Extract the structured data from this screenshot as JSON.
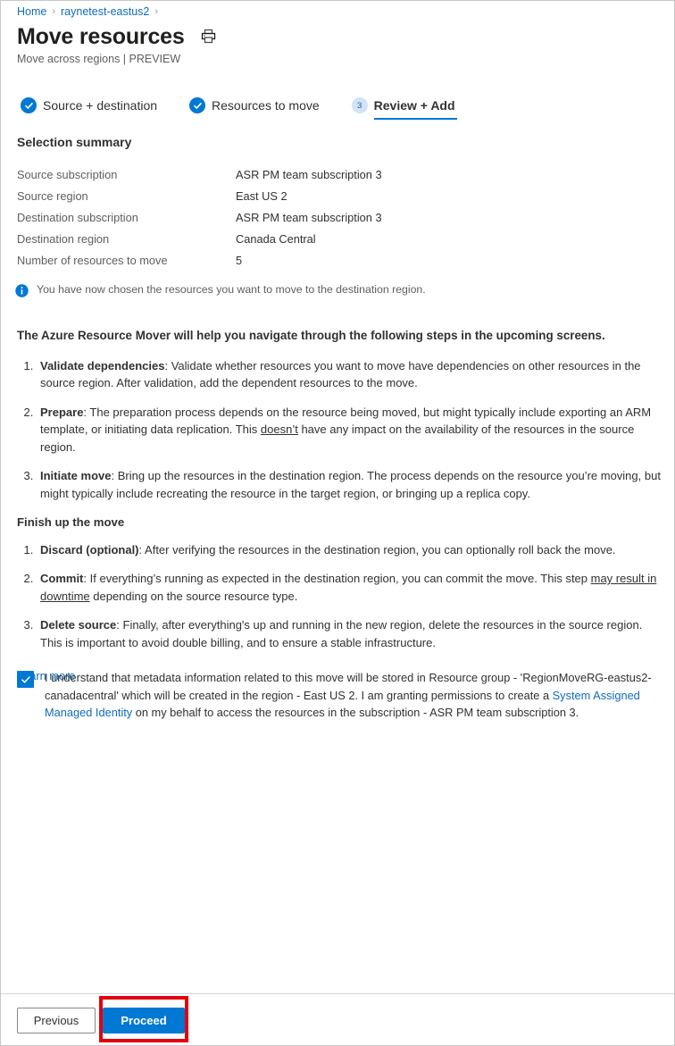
{
  "breadcrumb": {
    "items": [
      {
        "label": "Home"
      },
      {
        "label": "raynetest-eastus2"
      }
    ],
    "separator": "›"
  },
  "header": {
    "title": "Move resources",
    "subtitle": "Move across regions | PREVIEW",
    "print_icon": "print-icon"
  },
  "steps": [
    {
      "label": "Source + destination",
      "state": "done",
      "badge": "✓"
    },
    {
      "label": "Resources to move",
      "state": "done",
      "badge": "✓"
    },
    {
      "label": "Review + Add",
      "state": "active",
      "badge": "3"
    }
  ],
  "selection_summary": {
    "title": "Selection summary",
    "rows": [
      {
        "label": "Source subscription",
        "value": "ASR PM team subscription 3"
      },
      {
        "label": "Source region",
        "value": "East US 2"
      },
      {
        "label": "Destination subscription",
        "value": "ASR PM team subscription 3"
      },
      {
        "label": "Destination region",
        "value": "Canada Central"
      },
      {
        "label": "Number of resources to move",
        "value": "5"
      }
    ]
  },
  "info_banner": {
    "icon": "info-icon",
    "text": "You have now chosen the resources you want to move to the destination region."
  },
  "body": {
    "lead": "The Azure Resource Mover will help you navigate through the following steps in the upcoming screens.",
    "upcoming_steps": [
      {
        "term": "Validate dependencies",
        "sep": ": ",
        "pre": "Validate whether resources you want to move have dependencies on other resources in the source region. After validation, add the dependent resources to the move.",
        "underlined": "",
        "post": ""
      },
      {
        "term": "Prepare",
        "sep": ": ",
        "pre": "The preparation process depends on the resource being moved, but might typically include exporting an ARM template, or initiating data replication. This ",
        "underlined": "doesn’t",
        "post": " have any impact on the availability of the resources in the source region."
      },
      {
        "term": "Initiate move",
        "sep": ": ",
        "pre": "Bring up the resources in the destination region. The process depends on the resource you’re moving, but might typically include recreating the resource in the target region, or bringing up a replica copy.",
        "underlined": "",
        "post": ""
      }
    ],
    "finish_heading": "Finish up the move",
    "finish_steps": [
      {
        "term": "Discard (optional)",
        "sep": ": ",
        "pre": "After verifying the resources in the destination region, you can optionally roll back the move.",
        "underlined": "",
        "post": ""
      },
      {
        "term": "Commit",
        "sep": ": ",
        "pre": "If everything’s running as expected in the destination region, you can commit the move. This step ",
        "underlined": "may result in downtime",
        "post": " depending on the source resource type."
      },
      {
        "term": "Delete source",
        "sep": ": ",
        "pre": "Finally, after everything's up and running in the new region, delete the resources in the source region. This is important to avoid double billing, and to ensure a stable infrastructure.",
        "underlined": "",
        "post": ""
      }
    ],
    "learn_more": "Learn more"
  },
  "consent": {
    "checked": true,
    "text_part1": "I understand that metadata information related to this move will be stored in Resource group - 'RegionMoveRG-eastus2-canadacentral' which will be created in the region - East US 2. I am granting permissions to create a ",
    "link_text": "System Assigned Managed Identity",
    "text_part2": " on my behalf to access the resources in the subscription - ASR PM team subscription 3."
  },
  "footer": {
    "previous_label": "Previous",
    "proceed_label": "Proceed",
    "highlight_color": "#e3000f",
    "accent_color": "#0078d4"
  }
}
